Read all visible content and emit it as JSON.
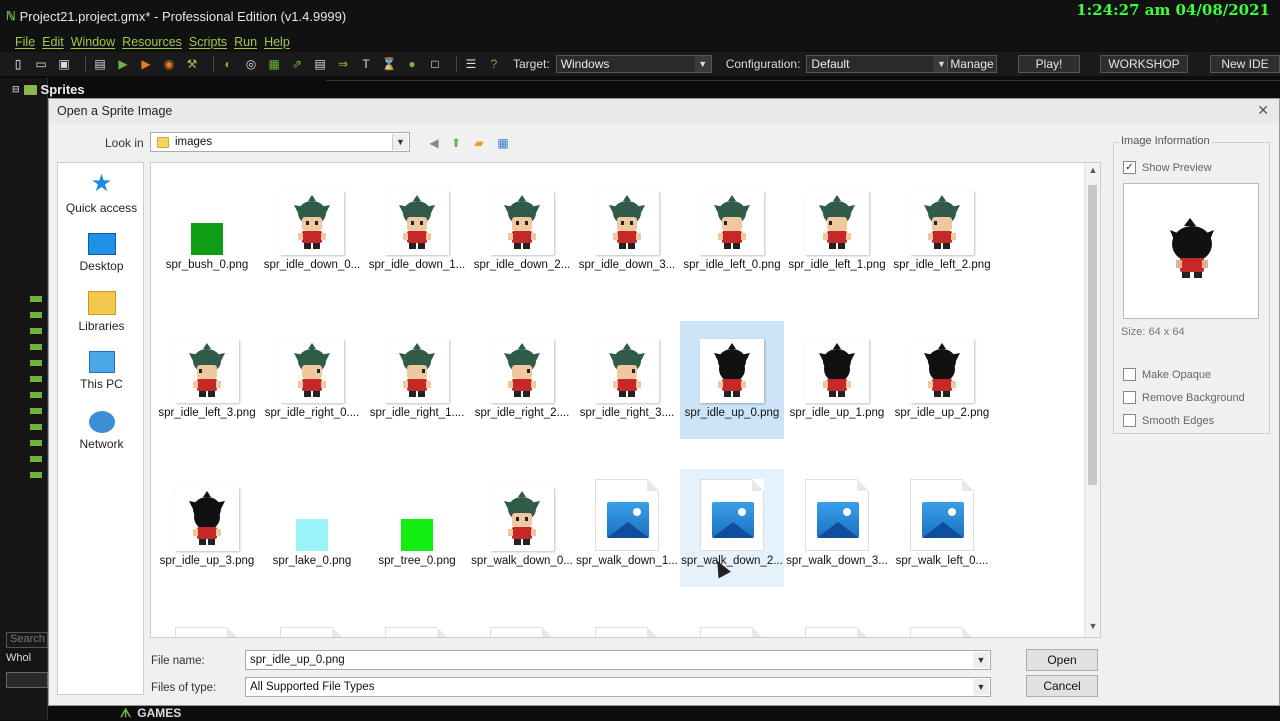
{
  "window": {
    "title": "Project21.project.gmx* - Professional Edition (v1.4.9999)",
    "clock": "1:24:27 am 04/08/2021"
  },
  "menu": [
    "File",
    "Edit",
    "Window",
    "Resources",
    "Scripts",
    "Run",
    "Help"
  ],
  "toolbar": {
    "target_label": "Target:",
    "target_value": "Windows",
    "config_label": "Configuration:",
    "config_value": "Default",
    "manage": "Manage",
    "play": "Play!",
    "workshop": "WORKSHOP",
    "new_ide": "New IDE"
  },
  "resources": {
    "header": "Sprites",
    "search_placeholder": "Search",
    "whole_label": "Whol"
  },
  "footer_logo": "GAMES",
  "dialog": {
    "title": "Open a Sprite Image",
    "look_in_label": "Look in",
    "look_in_value": "images",
    "places": [
      "Quick access",
      "Desktop",
      "Libraries",
      "This PC",
      "Network"
    ],
    "files": [
      {
        "name": "spr_bush_0.png",
        "thumb": "green-square"
      },
      {
        "name": "spr_idle_down_0...",
        "thumb": "character-front"
      },
      {
        "name": "spr_idle_down_1...",
        "thumb": "character-front"
      },
      {
        "name": "spr_idle_down_2...",
        "thumb": "character-front"
      },
      {
        "name": "spr_idle_down_3...",
        "thumb": "character-front"
      },
      {
        "name": "spr_idle_left_0.png",
        "thumb": "character-left"
      },
      {
        "name": "spr_idle_left_1.png",
        "thumb": "character-left"
      },
      {
        "name": "spr_idle_left_2.png",
        "thumb": "character-left"
      },
      {
        "name": "spr_idle_left_3.png",
        "thumb": "character-left"
      },
      {
        "name": "spr_idle_right_0....",
        "thumb": "character-right"
      },
      {
        "name": "spr_idle_right_1....",
        "thumb": "character-right"
      },
      {
        "name": "spr_idle_right_2....",
        "thumb": "character-right"
      },
      {
        "name": "spr_idle_right_3....",
        "thumb": "character-right"
      },
      {
        "name": "spr_idle_up_0.png",
        "thumb": "character-back",
        "selected": true
      },
      {
        "name": "spr_idle_up_1.png",
        "thumb": "character-back"
      },
      {
        "name": "spr_idle_up_2.png",
        "thumb": "character-back"
      },
      {
        "name": "spr_idle_up_3.png",
        "thumb": "character-back"
      },
      {
        "name": "spr_lake_0.png",
        "thumb": "cyan-square"
      },
      {
        "name": "spr_tree_0.png",
        "thumb": "lime-square"
      },
      {
        "name": "spr_walk_down_0...",
        "thumb": "character-front"
      },
      {
        "name": "spr_walk_down_1...",
        "thumb": "photo-icon"
      },
      {
        "name": "spr_walk_down_2...",
        "thumb": "photo-icon",
        "hover": true
      },
      {
        "name": "spr_walk_down_3...",
        "thumb": "photo-icon"
      },
      {
        "name": "spr_walk_left_0....",
        "thumb": "photo-icon"
      },
      {
        "name": "",
        "thumb": "photo-icon"
      },
      {
        "name": "",
        "thumb": "photo-icon"
      },
      {
        "name": "",
        "thumb": "photo-icon"
      },
      {
        "name": "",
        "thumb": "photo-icon"
      },
      {
        "name": "",
        "thumb": "photo-icon"
      },
      {
        "name": "",
        "thumb": "photo-icon"
      },
      {
        "name": "",
        "thumb": "photo-icon"
      },
      {
        "name": "",
        "thumb": "photo-icon"
      }
    ],
    "file_name_label": "File name:",
    "file_name_value": "spr_idle_up_0.png",
    "files_of_type_label": "Files of type:",
    "files_of_type_value": "All Supported File Types",
    "open": "Open",
    "cancel": "Cancel",
    "image_info": {
      "title": "Image Information",
      "show_preview": "Show Preview",
      "show_preview_checked": true,
      "size": "Size: 64 x 64",
      "make_opaque": "Make Opaque",
      "remove_background": "Remove Background",
      "smooth_edges": "Smooth Edges"
    }
  },
  "colors": {
    "accent_green": "#6db43f",
    "selection": "#cce4f7",
    "clock": "#3cff3c"
  }
}
